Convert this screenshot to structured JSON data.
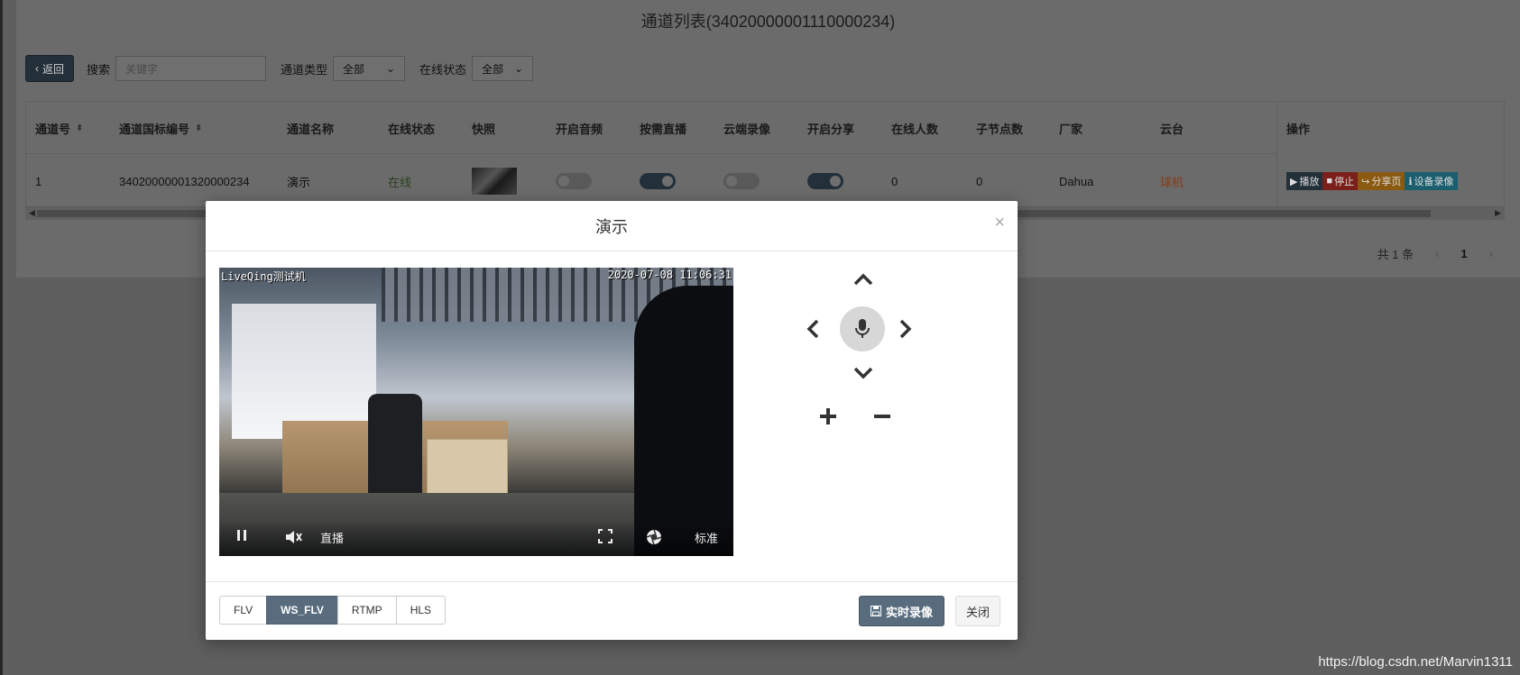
{
  "page": {
    "title": "通道列表(34020000001110000234)",
    "back_label": "返回",
    "search_label": "搜索",
    "search_placeholder": "关键字",
    "channel_type_label": "通道类型",
    "channel_type_value": "全部",
    "online_status_label": "在线状态",
    "online_status_value": "全部"
  },
  "table": {
    "headers": [
      "通道号",
      "通道国标编号",
      "通道名称",
      "在线状态",
      "快照",
      "开启音频",
      "按需直播",
      "云端录像",
      "开启分享",
      "在线人数",
      "子节点数",
      "厂家",
      "云台",
      "操作"
    ],
    "row": {
      "channel_no": "1",
      "gb_id": "34020000001320000234",
      "name": "演示",
      "status": "在线",
      "audio_on": false,
      "on_demand": true,
      "cloud_record": false,
      "share_on": true,
      "online_count": "0",
      "child_count": "0",
      "vendor": "Dahua",
      "ptz_type": "球机"
    },
    "ops": {
      "play": "播放",
      "stop": "停止",
      "share": "分享页",
      "record": "设备录像"
    }
  },
  "pager": {
    "total": "共 1 条",
    "prev": "‹",
    "current": "1",
    "next": "›"
  },
  "modal": {
    "title": "演示",
    "close_x": "×",
    "osd_left": "LiveQing测试机",
    "osd_right": "2020-07-08 11:06:31",
    "live_label": "直播",
    "quality_label": "标准",
    "formats": [
      "FLV",
      "WS_FLV",
      "RTMP",
      "HLS"
    ],
    "active_format": "WS_FLV",
    "record_label": "实时录像",
    "close_label": "关闭"
  },
  "watermark": "https://blog.csdn.net/Marvin1311"
}
